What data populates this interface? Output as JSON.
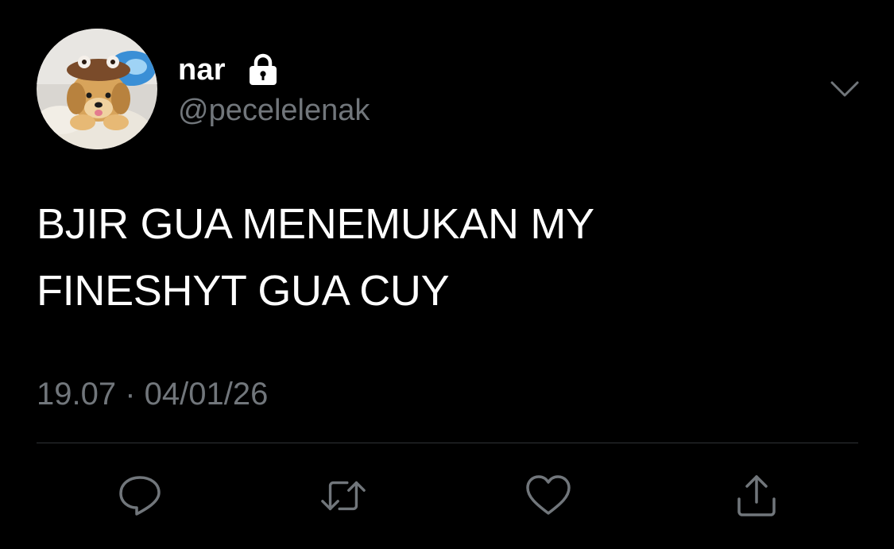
{
  "user": {
    "display_name": "nar",
    "handle": "@pecelelenak",
    "avatar_icon": "puppy-avatar",
    "protected_icon": "lock-icon"
  },
  "tweet": {
    "text": "BJIR GUA MENEMUKAN MY FINESHYT GUA CUY",
    "line1": "BJIR GUA MENEMUKAN MY",
    "line2": "FINESHYT GUA CUY",
    "timestamp": "19.07 · 04/01/26"
  },
  "actions": [
    {
      "name": "reply",
      "icon": "reply-icon"
    },
    {
      "name": "retweet",
      "icon": "retweet-icon"
    },
    {
      "name": "like",
      "icon": "heart-icon"
    },
    {
      "name": "share",
      "icon": "share-icon"
    }
  ],
  "colors": {
    "background": "#000000",
    "text_primary": "#ffffff",
    "text_secondary": "#71767b",
    "divider": "#2f3336"
  }
}
